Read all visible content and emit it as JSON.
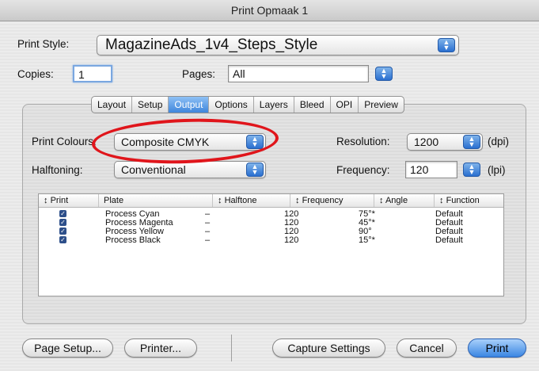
{
  "window": {
    "title": "Print Opmaak 1"
  },
  "print_style": {
    "label": "Print Style:",
    "value": "MagazineAds_1v4_Steps_Style"
  },
  "copies": {
    "label": "Copies:",
    "value": "1"
  },
  "pages": {
    "label": "Pages:",
    "value": "All"
  },
  "tabs": [
    {
      "label": "Layout"
    },
    {
      "label": "Setup"
    },
    {
      "label": "Output",
      "active": true
    },
    {
      "label": "Options"
    },
    {
      "label": "Layers"
    },
    {
      "label": "Bleed"
    },
    {
      "label": "OPI"
    },
    {
      "label": "Preview"
    }
  ],
  "output": {
    "print_colours": {
      "label": "Print Colours:",
      "value": "Composite CMYK"
    },
    "halftoning": {
      "label": "Halftoning:",
      "value": "Conventional"
    },
    "resolution": {
      "label": "Resolution:",
      "value": "1200",
      "unit": "(dpi)"
    },
    "frequency": {
      "label": "Frequency:",
      "value": "120",
      "unit": "(lpi)"
    }
  },
  "table": {
    "headers": [
      "Print",
      "Plate",
      "Halftone",
      "Frequency",
      "Angle",
      "Function"
    ],
    "sort_glyph": "↕",
    "rows": [
      {
        "plate": "Process Cyan",
        "halftone": "–",
        "frequency": "120",
        "angle": "75°*",
        "function": "Default"
      },
      {
        "plate": "Process Magenta",
        "halftone": "–",
        "frequency": "120",
        "angle": "45°*",
        "function": "Default"
      },
      {
        "plate": "Process Yellow",
        "halftone": "–",
        "frequency": "120",
        "angle": "90°",
        "function": "Default"
      },
      {
        "plate": "Process Black",
        "halftone": "–",
        "frequency": "120",
        "angle": "15°*",
        "function": "Default"
      }
    ]
  },
  "buttons": {
    "page_setup": "Page Setup...",
    "printer": "Printer...",
    "capture_settings": "Capture Settings",
    "cancel": "Cancel",
    "print": "Print"
  },
  "icons": {
    "popup_arrows": "updown-arrows-icon",
    "checkbox": "checkmark-icon"
  },
  "colors": {
    "accent": "#3f86dc",
    "annotation": "#e0151b"
  }
}
